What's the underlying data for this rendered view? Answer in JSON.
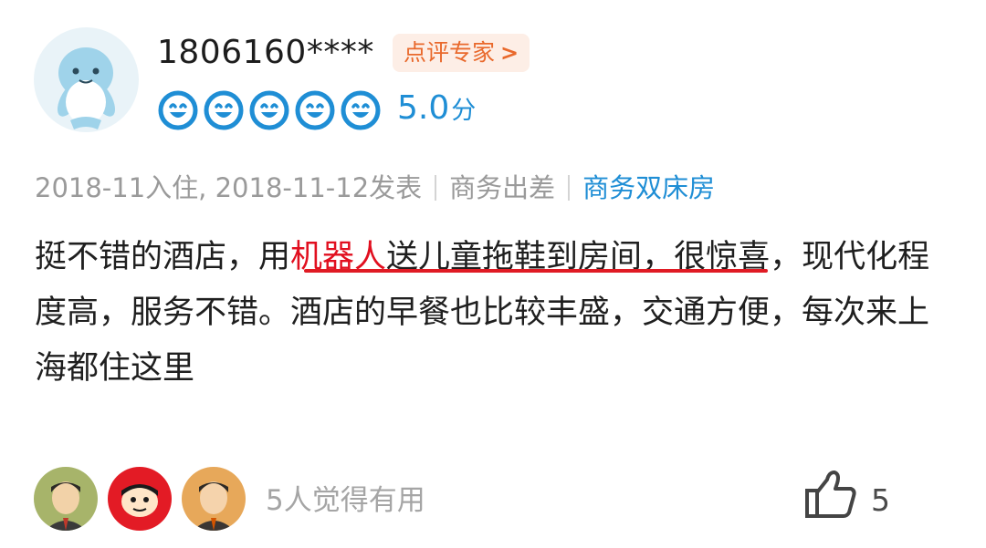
{
  "reviewer": {
    "username": "1806160****",
    "badge_label": "点评专家",
    "badge_chevron": ">",
    "rating_icons": [
      "smiley-icon",
      "smiley-icon",
      "smiley-icon",
      "smiley-icon",
      "smiley-icon"
    ],
    "score": "5.0",
    "score_unit": "分"
  },
  "meta": {
    "dates": "2018-11入住, 2018-11-12发表",
    "trip_type": "商务出差",
    "room_type": "商务双床房"
  },
  "review": {
    "part1": "挺不错的酒店，",
    "part2": "用",
    "highlight": "机器人",
    "part3": "送儿童拖鞋到房间",
    "part4": "，很惊喜，现代化程度高，服务不错。酒店的早餐也比较丰盛，交通方便，每次来上海都住这里"
  },
  "footer": {
    "useful_text": "5人觉得有用",
    "like_count": "5"
  },
  "colors": {
    "accent_blue": "#1f8ed5",
    "badge_orange": "#e9692c",
    "highlight_red": "#e10f1f"
  }
}
